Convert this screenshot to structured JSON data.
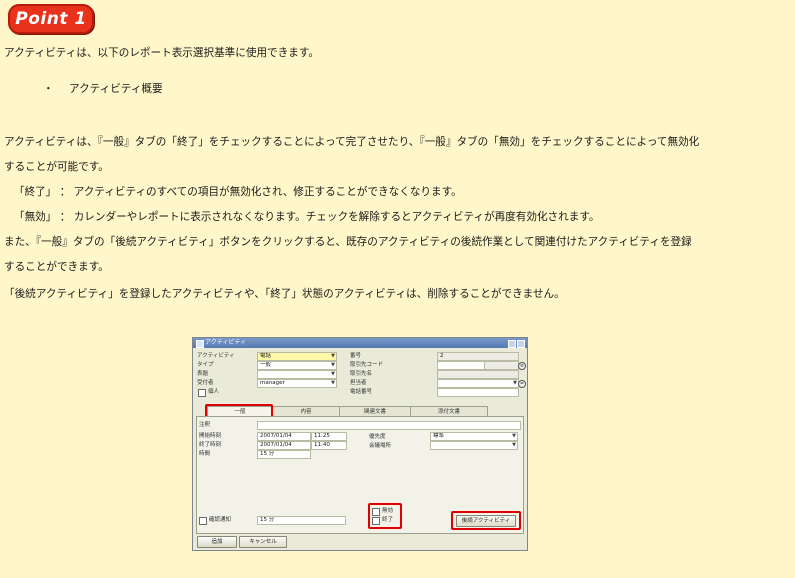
{
  "badge": "Point 1",
  "paragraphs": {
    "intro": "アクティビティは、以下のレポート表示選択基準に使用できます。",
    "bullet_mark": "・",
    "bullet_item": "アクティビティ概要",
    "p1_line1": "アクティビティは、『一般』タブの「終了」をチェックすることによって完了させたり、『一般』タブの「無効」をチェックすることによって無効化",
    "p1_line2": "することが可能です。",
    "end_def": "「終了」 ： アクティビティのすべての項目が無効化され、修正することができなくなります。",
    "invalid_def": "「無効」 ： カレンダーやレポートに表示されなくなります。チェックを解除するとアクティビティが再度有効化されます。",
    "p2_line1": "また、『一般』タブの「後続アクティビティ」ボタンをクリックすると、既存のアクティビティの後続作業として関連付けたアクティビティを登録",
    "p2_line2": "することができます。",
    "p3": "「後続アクティビティ」を登録したアクティビティや、「終了」状態のアクティビティは、削除することができません。"
  },
  "window": {
    "title": "アクティビティ",
    "left_fields": [
      {
        "label": "アクティビティ",
        "value": "電話"
      },
      {
        "label": "タイプ",
        "value": "一般"
      },
      {
        "label": "表題",
        "value": ""
      },
      {
        "label": "受付者",
        "value": "manager"
      }
    ],
    "personal_label": "個人",
    "right_fields": [
      {
        "label": "番号",
        "value": "2"
      },
      {
        "label": "取引先コード",
        "value": ""
      },
      {
        "label": "取引先名",
        "value": ""
      },
      {
        "label": "担当者",
        "value": ""
      },
      {
        "label": "電話番号",
        "value": ""
      }
    ],
    "tabs": [
      "一般",
      "内容",
      "関連文書",
      "添付文書"
    ],
    "general": {
      "remarks_label": "注釈",
      "start_label": "開始時刻",
      "start_date": "2007/01/04",
      "start_time": "11:25",
      "end_label": "終了時刻",
      "end_date": "2007/01/04",
      "end_time": "11:40",
      "duration_label": "時間",
      "duration_value": "15 分",
      "priority_label": "優先度",
      "priority_value": "標準",
      "location_label": "会議場所",
      "location_value": "",
      "invalid_label": "無効",
      "closed_label": "終了",
      "reminder_label": "確認通知",
      "reminder_value": "15 分",
      "followup_button": "後続アクティビティ"
    },
    "buttons": {
      "add": "追加",
      "cancel": "キャンセル"
    }
  }
}
